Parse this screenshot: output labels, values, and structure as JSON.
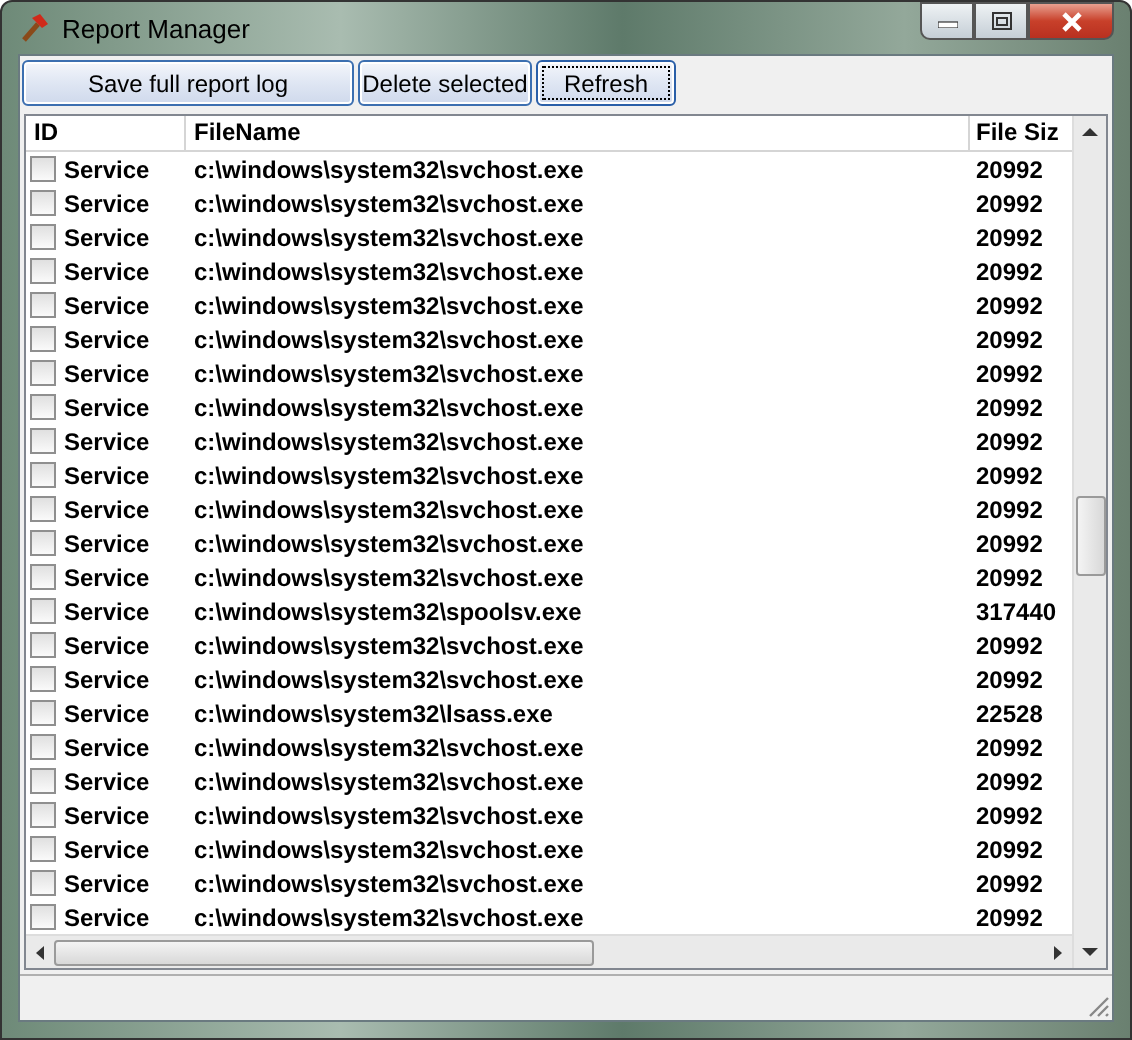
{
  "window": {
    "title": "Report Manager"
  },
  "toolbar": [
    {
      "label": "Save full report log",
      "selected": false
    },
    {
      "label": "Delete selected",
      "selected": false
    },
    {
      "label": "Refresh",
      "selected": true
    }
  ],
  "table": {
    "columns": [
      "ID",
      "FileName",
      "File Siz"
    ],
    "rows": [
      {
        "checked": false,
        "id": "Service",
        "file": "c:\\windows\\system32\\svchost.exe",
        "size": "20992"
      },
      {
        "checked": false,
        "id": "Service",
        "file": "c:\\windows\\system32\\svchost.exe",
        "size": "20992"
      },
      {
        "checked": false,
        "id": "Service",
        "file": "c:\\windows\\system32\\svchost.exe",
        "size": "20992"
      },
      {
        "checked": false,
        "id": "Service",
        "file": "c:\\windows\\system32\\svchost.exe",
        "size": "20992"
      },
      {
        "checked": false,
        "id": "Service",
        "file": "c:\\windows\\system32\\svchost.exe",
        "size": "20992"
      },
      {
        "checked": false,
        "id": "Service",
        "file": "c:\\windows\\system32\\svchost.exe",
        "size": "20992"
      },
      {
        "checked": false,
        "id": "Service",
        "file": "c:\\windows\\system32\\svchost.exe",
        "size": "20992"
      },
      {
        "checked": false,
        "id": "Service",
        "file": "c:\\windows\\system32\\svchost.exe",
        "size": "20992"
      },
      {
        "checked": false,
        "id": "Service",
        "file": "c:\\windows\\system32\\svchost.exe",
        "size": "20992"
      },
      {
        "checked": false,
        "id": "Service",
        "file": "c:\\windows\\system32\\svchost.exe",
        "size": "20992"
      },
      {
        "checked": false,
        "id": "Service",
        "file": "c:\\windows\\system32\\svchost.exe",
        "size": "20992"
      },
      {
        "checked": false,
        "id": "Service",
        "file": "c:\\windows\\system32\\svchost.exe",
        "size": "20992"
      },
      {
        "checked": false,
        "id": "Service",
        "file": "c:\\windows\\system32\\svchost.exe",
        "size": "20992"
      },
      {
        "checked": false,
        "id": "Service",
        "file": "c:\\windows\\system32\\spoolsv.exe",
        "size": "317440"
      },
      {
        "checked": false,
        "id": "Service",
        "file": "c:\\windows\\system32\\svchost.exe",
        "size": "20992"
      },
      {
        "checked": false,
        "id": "Service",
        "file": "c:\\windows\\system32\\svchost.exe",
        "size": "20992"
      },
      {
        "checked": false,
        "id": "Service",
        "file": "c:\\windows\\system32\\lsass.exe",
        "size": "22528"
      },
      {
        "checked": false,
        "id": "Service",
        "file": "c:\\windows\\system32\\svchost.exe",
        "size": "20992"
      },
      {
        "checked": false,
        "id": "Service",
        "file": "c:\\windows\\system32\\svchost.exe",
        "size": "20992"
      },
      {
        "checked": false,
        "id": "Service",
        "file": "c:\\windows\\system32\\svchost.exe",
        "size": "20992"
      },
      {
        "checked": false,
        "id": "Service",
        "file": "c:\\windows\\system32\\svchost.exe",
        "size": "20992"
      },
      {
        "checked": false,
        "id": "Service",
        "file": "c:\\windows\\system32\\svchost.exe",
        "size": "20992"
      },
      {
        "checked": false,
        "id": "Service",
        "file": "c:\\windows\\system32\\svchost.exe",
        "size": "20992"
      }
    ]
  }
}
